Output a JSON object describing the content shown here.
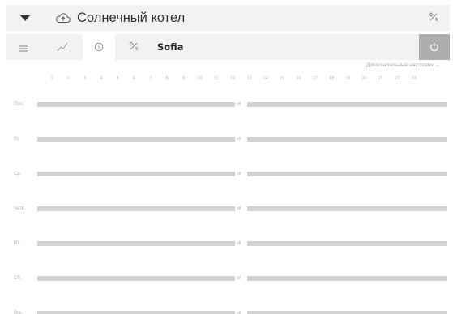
{
  "header": {
    "title": "Солнечный котел"
  },
  "tabs": {
    "device_name": "Sofia"
  },
  "settings_link": "Дополнительные настройки",
  "hours": [
    "1",
    "2",
    "3",
    "4",
    "5",
    "6",
    "7",
    "8",
    "9",
    "10",
    "11",
    "12",
    "13",
    "14",
    "15",
    "16",
    "17",
    "18",
    "19",
    "20",
    "21",
    "22",
    "23"
  ],
  "off_label": "off",
  "days": [
    {
      "label": "Пон."
    },
    {
      "label": "Вт."
    },
    {
      "label": "Ср."
    },
    {
      "label": "Четв."
    },
    {
      "label": "Пт."
    },
    {
      "label": "Сб."
    },
    {
      "label": "Вск."
    }
  ]
}
